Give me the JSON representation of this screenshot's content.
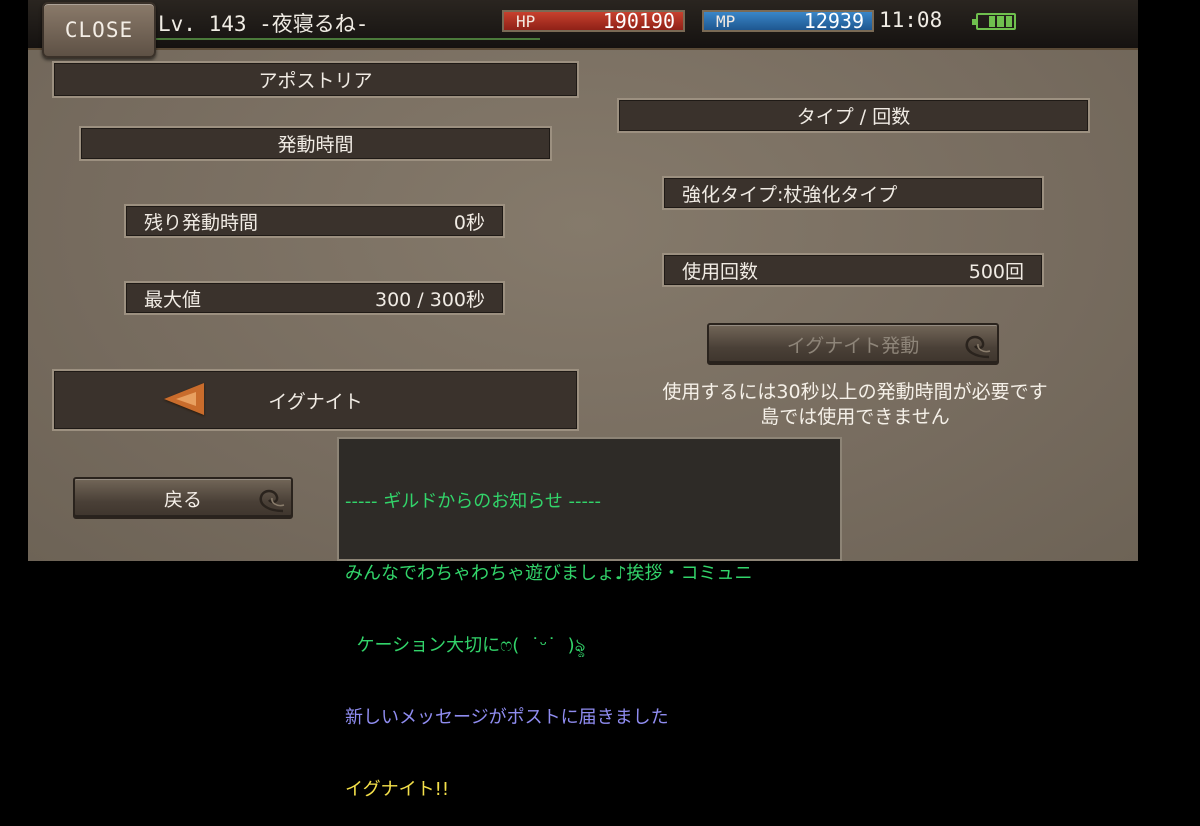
{
  "header": {
    "close_label": "CLOSE",
    "level_text": "Lv. 143 -夜寝るね-",
    "hp_label": "HP",
    "hp_value": "190190",
    "mp_label": "MP",
    "mp_value": "12939",
    "clock": "11:08",
    "battery_level": 0.75,
    "colors": {
      "hp": "#b8352a",
      "mp": "#2a74b8",
      "battery": "#6fc04e"
    }
  },
  "left": {
    "title": "アポストリア",
    "section_header": "発動時間",
    "remaining_label": "残り発動時間",
    "remaining_value": "0秒",
    "max_label": "最大値",
    "max_value": "300 / 300秒",
    "ignite_tab": "イグナイト",
    "back_label": "戻る"
  },
  "right": {
    "section_header": "タイプ / 回数",
    "enhance_type": "強化タイプ:杖強化タイプ",
    "uses_label": "使用回数",
    "uses_value": "500回",
    "ignite_button": "イグナイト発動",
    "warning_line1": "使用するには30秒以上の発動時間が必要です",
    "warning_line2": "島では使用できません"
  },
  "chat": {
    "lines": [
      "----- ギルドからのお知らせ -----",
      "みんなでわちゃわちゃ遊びましょ♪挨拶・コミュニ",
      "  ケーション大切にෆ(  ˙ᵕ˙  )ৡ",
      "新しいメッセージがポストに届きました",
      "イグナイト!!"
    ],
    "colors": {
      "notice": "#32d46a",
      "system": "#8f8cf0",
      "ignite": "#f4e04a"
    }
  }
}
